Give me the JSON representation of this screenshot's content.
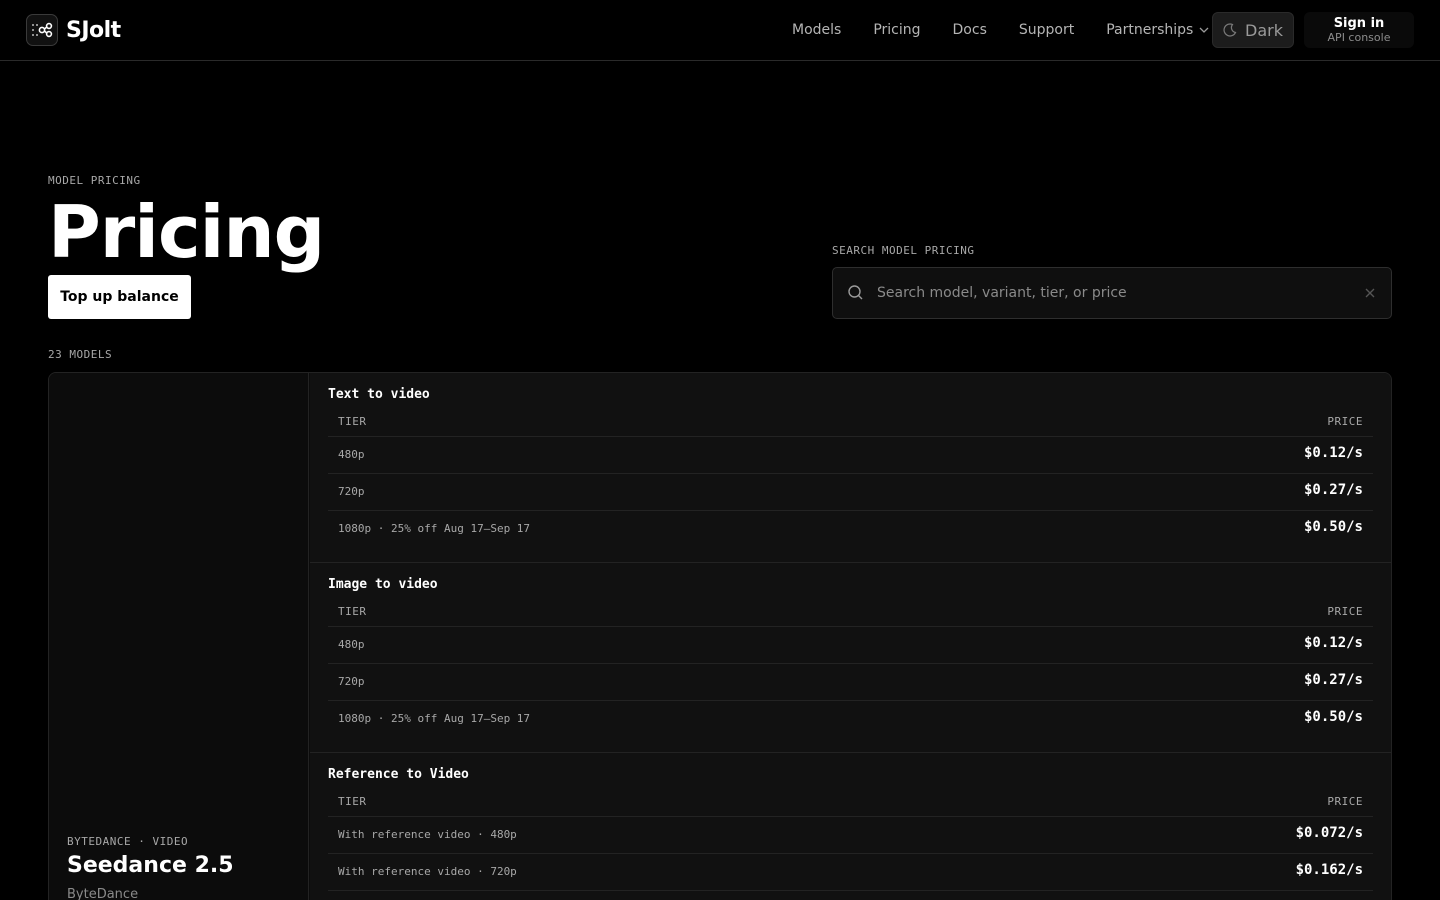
{
  "nav": {
    "brand": "SJolt",
    "links": [
      {
        "label": "Models"
      },
      {
        "label": "Pricing"
      },
      {
        "label": "Docs"
      },
      {
        "label": "Support"
      },
      {
        "label": "Partnerships"
      }
    ],
    "theme_label": "Dark",
    "signin_label": "Sign in",
    "signin_sub": "API console"
  },
  "hero": {
    "eyebrow": "MODEL PRICING",
    "title": "Pricing",
    "topup_label": "Top up balance"
  },
  "search": {
    "label": "SEARCH MODEL PRICING",
    "placeholder": "Search model, variant, tier, or price",
    "value": ""
  },
  "count_label": "23 MODELS",
  "model": {
    "meta": "BYTEDANCE · VIDEO",
    "name": "Seedance 2.5",
    "vendor": "ByteDance",
    "table_headers": {
      "tier": "TIER",
      "price": "PRICE"
    },
    "sections": [
      {
        "title": "Text to video",
        "rows": [
          {
            "tier": "480p",
            "price": "$0.12/s"
          },
          {
            "tier": "720p",
            "price": "$0.27/s"
          },
          {
            "tier": "1080p · 25% off Aug 17–Sep 17",
            "price": "$0.50/s"
          }
        ]
      },
      {
        "title": "Image to video",
        "rows": [
          {
            "tier": "480p",
            "price": "$0.12/s"
          },
          {
            "tier": "720p",
            "price": "$0.27/s"
          },
          {
            "tier": "1080p · 25% off Aug 17–Sep 17",
            "price": "$0.50/s"
          }
        ]
      },
      {
        "title": "Reference to Video",
        "rows": [
          {
            "tier": "With reference video · 480p",
            "price": "$0.072/s"
          },
          {
            "tier": "With reference video · 720p",
            "price": "$0.162/s"
          }
        ]
      }
    ]
  }
}
